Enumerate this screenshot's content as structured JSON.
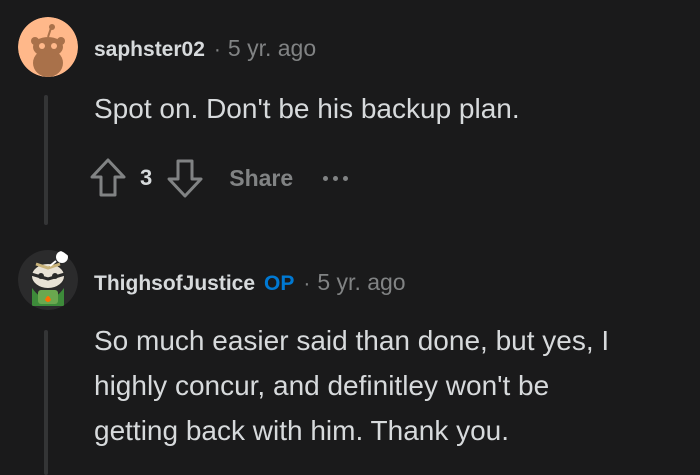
{
  "comments": [
    {
      "username": "saphster02",
      "separator": "·",
      "time": "5 yr. ago",
      "body": "Spot on. Don't be his backup plan.",
      "score": "3",
      "share_label": "Share",
      "avatar_icon": "reddit-snoo-avatar-icon"
    },
    {
      "username": "ThighsofJustice",
      "op_badge": "OP",
      "separator": "·",
      "time": "5 yr. ago",
      "body_lines": [
        "So much easier said than done, but yes, I",
        "highly concur, and definitley won't be",
        "getting back with him. Thank you."
      ],
      "avatar_icon": "custom-snoo-avatar-icon"
    }
  ],
  "colors": {
    "background": "#1a1a1b",
    "text": "#d7dadc",
    "muted": "#818384",
    "op_blue": "#0079d3",
    "thread_line": "#343536"
  },
  "icons": [
    "upvote-icon",
    "downvote-icon",
    "more-options-icon"
  ]
}
